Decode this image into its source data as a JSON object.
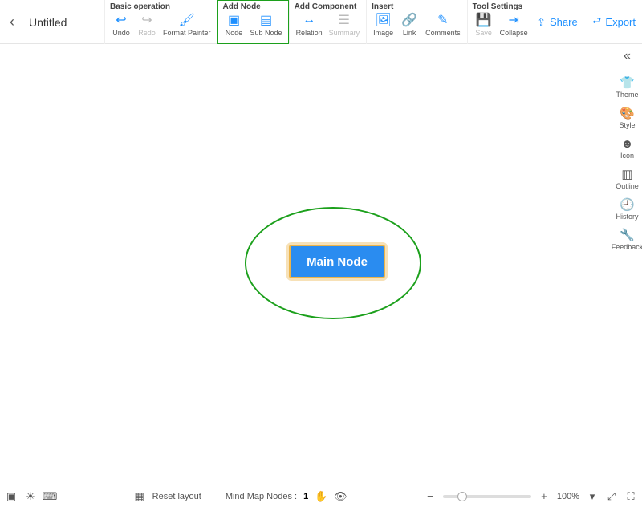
{
  "header": {
    "title": "Untitled",
    "sections": {
      "basic": {
        "label": "Basic operation",
        "undo": "Undo",
        "redo": "Redo",
        "format_painter": "Format Painter"
      },
      "add_node": {
        "label": "Add Node",
        "node": "Node",
        "sub_node": "Sub Node"
      },
      "add_component": {
        "label": "Add Component",
        "relation": "Relation",
        "summary": "Summary"
      },
      "insert": {
        "label": "Insert",
        "image": "Image",
        "link": "Link",
        "comments": "Comments"
      },
      "tool_settings": {
        "label": "Tool Settings",
        "save": "Save",
        "collapse": "Collapse"
      }
    },
    "share": "Share",
    "export": "Export"
  },
  "canvas": {
    "main_node": "Main Node"
  },
  "sidebar": {
    "theme": "Theme",
    "style": "Style",
    "iconlbl": "Icon",
    "outline": "Outline",
    "history": "History",
    "feedback": "Feedback"
  },
  "bottom": {
    "reset_layout": "Reset layout",
    "mind_map_label": "Mind Map Nodes :",
    "mind_map_count": "1",
    "zoom_percent": "100%"
  }
}
